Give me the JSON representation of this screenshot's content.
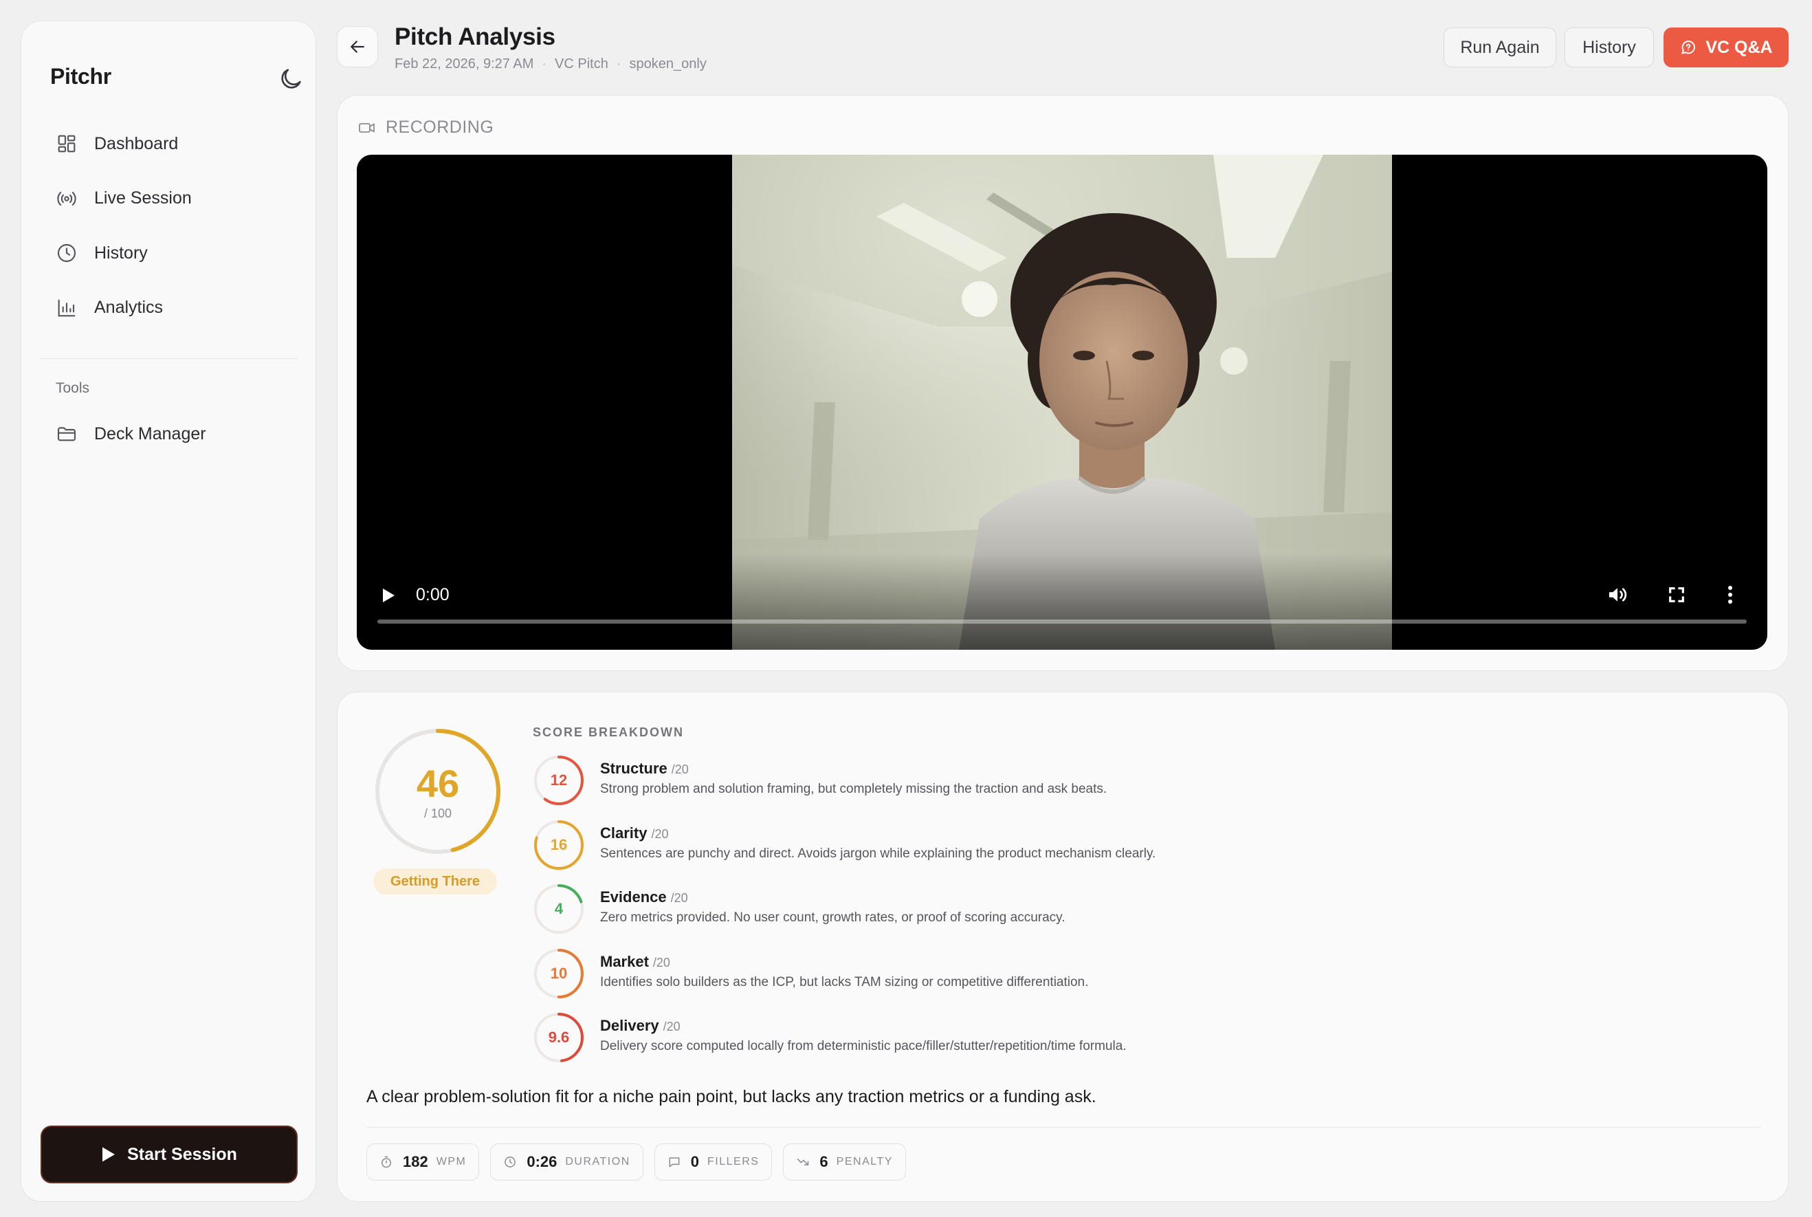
{
  "app": {
    "brand": "Pitchr"
  },
  "sidebar": {
    "items": [
      {
        "label": "Dashboard",
        "icon": "dashboard-icon"
      },
      {
        "label": "Live Session",
        "icon": "broadcast-icon"
      },
      {
        "label": "History",
        "icon": "clock-icon"
      },
      {
        "label": "Analytics",
        "icon": "bar-chart-icon"
      }
    ],
    "tools_label": "Tools",
    "tools": [
      {
        "label": "Deck Manager",
        "icon": "folder-icon"
      }
    ],
    "start_label": "Start Session"
  },
  "header": {
    "title": "Pitch Analysis",
    "date": "Feb 22, 2026, 9:27 AM",
    "type": "VC Pitch",
    "mode": "spoken_only",
    "run_again_label": "Run Again",
    "history_label": "History",
    "vc_label": "VC Q&A"
  },
  "recording": {
    "label": "RECORDING",
    "time": "0:00"
  },
  "score": {
    "value": "46",
    "of": "/ 100",
    "fraction": 0.46,
    "status": "Getting There",
    "breakdown_title": "SCORE BREAKDOWN",
    "breakdown": [
      {
        "value": "12",
        "fraction": 0.6,
        "name": "Structure",
        "max": "/20",
        "color": "#e3553f",
        "desc": "Strong problem and solution framing, but completely missing the traction and ask beats."
      },
      {
        "value": "16",
        "fraction": 0.8,
        "name": "Clarity",
        "max": "/20",
        "color": "#e5a52c",
        "desc": "Sentences are punchy and direct. Avoids jargon while explaining the product mechanism clearly."
      },
      {
        "value": "4",
        "fraction": 0.2,
        "name": "Evidence",
        "max": "/20",
        "color": "#45b05b",
        "desc": "Zero metrics provided. No user count, growth rates, or proof of scoring accuracy."
      },
      {
        "value": "10",
        "fraction": 0.5,
        "name": "Market",
        "max": "/20",
        "color": "#e57a35",
        "desc": "Identifies solo builders as the ICP, but lacks TAM sizing or competitive differentiation."
      },
      {
        "value": "9.6",
        "fraction": 0.48,
        "name": "Delivery",
        "max": "/20",
        "color": "#dc4a3c",
        "desc": "Delivery score computed locally from deterministic pace/filler/stutter/repetition/time formula."
      }
    ],
    "summary": "A clear problem-solution fit for a niche pain point, but lacks any traction metrics or a funding ask.",
    "stats": [
      {
        "value": "182",
        "unit": "WPM",
        "icon": "stopwatch-icon"
      },
      {
        "value": "0:26",
        "unit": "DURATION",
        "icon": "clock-icon"
      },
      {
        "value": "0",
        "unit": "FILLERS",
        "icon": "message-icon"
      },
      {
        "value": "6",
        "unit": "PENALTY",
        "icon": "trending-down-icon"
      }
    ]
  },
  "colors": {
    "accent": "#ed5a43",
    "score": "#e0a628",
    "status_bg": "#fcefd7"
  }
}
